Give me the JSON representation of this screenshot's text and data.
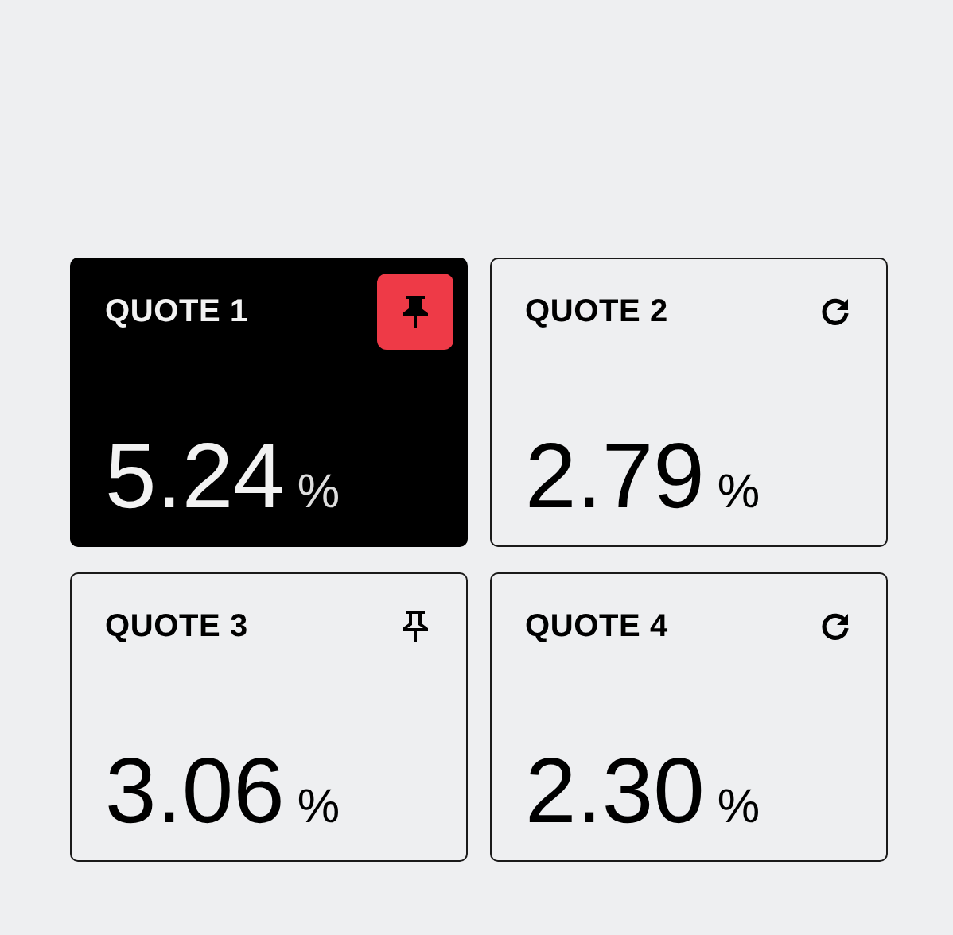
{
  "quotes": [
    {
      "label": "QUOTE 1",
      "value": "5.24",
      "unit": "%",
      "selected": true,
      "kind": "pin"
    },
    {
      "label": "QUOTE 2",
      "value": "2.79",
      "unit": "%",
      "selected": false,
      "kind": "refresh"
    },
    {
      "label": "QUOTE 3",
      "value": "3.06",
      "unit": "%",
      "selected": false,
      "kind": "pin"
    },
    {
      "label": "QUOTE 4",
      "value": "2.30",
      "unit": "%",
      "selected": false,
      "kind": "refresh"
    }
  ]
}
